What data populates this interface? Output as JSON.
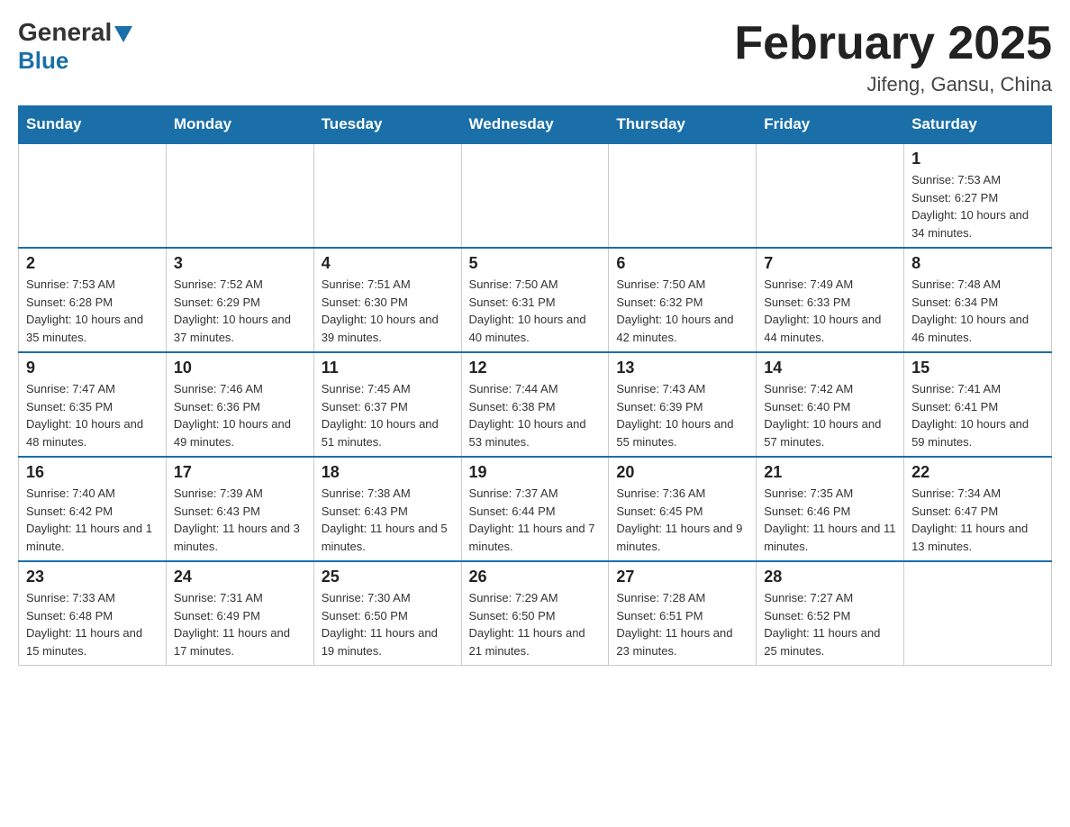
{
  "logo": {
    "general": "General",
    "blue": "Blue"
  },
  "header": {
    "title": "February 2025",
    "location": "Jifeng, Gansu, China"
  },
  "days_of_week": [
    "Sunday",
    "Monday",
    "Tuesday",
    "Wednesday",
    "Thursday",
    "Friday",
    "Saturday"
  ],
  "weeks": [
    {
      "days": [
        {
          "number": "",
          "info": "",
          "empty": true
        },
        {
          "number": "",
          "info": "",
          "empty": true
        },
        {
          "number": "",
          "info": "",
          "empty": true
        },
        {
          "number": "",
          "info": "",
          "empty": true
        },
        {
          "number": "",
          "info": "",
          "empty": true
        },
        {
          "number": "",
          "info": "",
          "empty": true
        },
        {
          "number": "1",
          "info": "Sunrise: 7:53 AM\nSunset: 6:27 PM\nDaylight: 10 hours and 34 minutes."
        }
      ]
    },
    {
      "days": [
        {
          "number": "2",
          "info": "Sunrise: 7:53 AM\nSunset: 6:28 PM\nDaylight: 10 hours and 35 minutes."
        },
        {
          "number": "3",
          "info": "Sunrise: 7:52 AM\nSunset: 6:29 PM\nDaylight: 10 hours and 37 minutes."
        },
        {
          "number": "4",
          "info": "Sunrise: 7:51 AM\nSunset: 6:30 PM\nDaylight: 10 hours and 39 minutes."
        },
        {
          "number": "5",
          "info": "Sunrise: 7:50 AM\nSunset: 6:31 PM\nDaylight: 10 hours and 40 minutes."
        },
        {
          "number": "6",
          "info": "Sunrise: 7:50 AM\nSunset: 6:32 PM\nDaylight: 10 hours and 42 minutes."
        },
        {
          "number": "7",
          "info": "Sunrise: 7:49 AM\nSunset: 6:33 PM\nDaylight: 10 hours and 44 minutes."
        },
        {
          "number": "8",
          "info": "Sunrise: 7:48 AM\nSunset: 6:34 PM\nDaylight: 10 hours and 46 minutes."
        }
      ]
    },
    {
      "days": [
        {
          "number": "9",
          "info": "Sunrise: 7:47 AM\nSunset: 6:35 PM\nDaylight: 10 hours and 48 minutes."
        },
        {
          "number": "10",
          "info": "Sunrise: 7:46 AM\nSunset: 6:36 PM\nDaylight: 10 hours and 49 minutes."
        },
        {
          "number": "11",
          "info": "Sunrise: 7:45 AM\nSunset: 6:37 PM\nDaylight: 10 hours and 51 minutes."
        },
        {
          "number": "12",
          "info": "Sunrise: 7:44 AM\nSunset: 6:38 PM\nDaylight: 10 hours and 53 minutes."
        },
        {
          "number": "13",
          "info": "Sunrise: 7:43 AM\nSunset: 6:39 PM\nDaylight: 10 hours and 55 minutes."
        },
        {
          "number": "14",
          "info": "Sunrise: 7:42 AM\nSunset: 6:40 PM\nDaylight: 10 hours and 57 minutes."
        },
        {
          "number": "15",
          "info": "Sunrise: 7:41 AM\nSunset: 6:41 PM\nDaylight: 10 hours and 59 minutes."
        }
      ]
    },
    {
      "days": [
        {
          "number": "16",
          "info": "Sunrise: 7:40 AM\nSunset: 6:42 PM\nDaylight: 11 hours and 1 minute."
        },
        {
          "number": "17",
          "info": "Sunrise: 7:39 AM\nSunset: 6:43 PM\nDaylight: 11 hours and 3 minutes."
        },
        {
          "number": "18",
          "info": "Sunrise: 7:38 AM\nSunset: 6:43 PM\nDaylight: 11 hours and 5 minutes."
        },
        {
          "number": "19",
          "info": "Sunrise: 7:37 AM\nSunset: 6:44 PM\nDaylight: 11 hours and 7 minutes."
        },
        {
          "number": "20",
          "info": "Sunrise: 7:36 AM\nSunset: 6:45 PM\nDaylight: 11 hours and 9 minutes."
        },
        {
          "number": "21",
          "info": "Sunrise: 7:35 AM\nSunset: 6:46 PM\nDaylight: 11 hours and 11 minutes."
        },
        {
          "number": "22",
          "info": "Sunrise: 7:34 AM\nSunset: 6:47 PM\nDaylight: 11 hours and 13 minutes."
        }
      ]
    },
    {
      "days": [
        {
          "number": "23",
          "info": "Sunrise: 7:33 AM\nSunset: 6:48 PM\nDaylight: 11 hours and 15 minutes."
        },
        {
          "number": "24",
          "info": "Sunrise: 7:31 AM\nSunset: 6:49 PM\nDaylight: 11 hours and 17 minutes."
        },
        {
          "number": "25",
          "info": "Sunrise: 7:30 AM\nSunset: 6:50 PM\nDaylight: 11 hours and 19 minutes."
        },
        {
          "number": "26",
          "info": "Sunrise: 7:29 AM\nSunset: 6:50 PM\nDaylight: 11 hours and 21 minutes."
        },
        {
          "number": "27",
          "info": "Sunrise: 7:28 AM\nSunset: 6:51 PM\nDaylight: 11 hours and 23 minutes."
        },
        {
          "number": "28",
          "info": "Sunrise: 7:27 AM\nSunset: 6:52 PM\nDaylight: 11 hours and 25 minutes."
        },
        {
          "number": "",
          "info": "",
          "empty": true
        }
      ]
    }
  ]
}
